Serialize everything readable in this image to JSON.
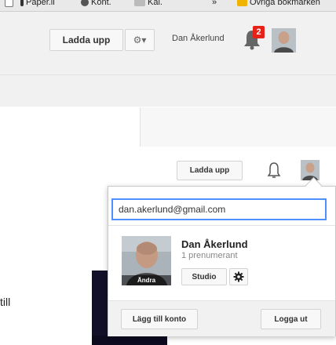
{
  "bookmarks": [
    {
      "label": "Paper.li",
      "icon": "page-icon",
      "color": "#333333"
    },
    {
      "label": "Kont.",
      "icon": "apple-icon",
      "color": "#555555"
    },
    {
      "label": "Kal.",
      "icon": "calendar-icon",
      "color": "#888888"
    },
    {
      "label": "»",
      "icon": "",
      "color": ""
    },
    {
      "label": "Övriga bokmärken",
      "icon": "folder-icon",
      "color": "#f0b400"
    }
  ],
  "header_top": {
    "upload_label": "Ladda upp",
    "gear_label": "⚙▾",
    "user_name": "Dan Åkerlund",
    "notification_count": "2"
  },
  "header_second": {
    "upload_label": "Ladda upp"
  },
  "account_popup": {
    "email": "dan.akerlund@gmail.com",
    "name": "Dan Åkerlund",
    "subscribers": "1 prenumerant",
    "change_photo_label": "Ändra",
    "studio_label": "Studio",
    "add_account_label": "Lägg till konto",
    "sign_out_label": "Logga ut"
  },
  "left_partial_text": "till",
  "colors": {
    "accent_blue": "#4d90fe",
    "badge_red": "#e62117",
    "header_gray": "#f1f1f1"
  }
}
